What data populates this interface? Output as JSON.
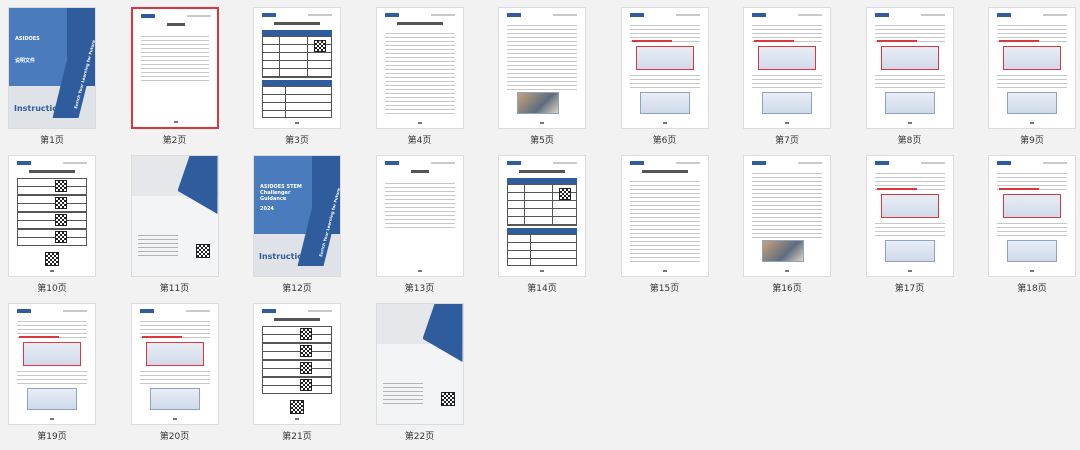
{
  "pages": [
    {
      "label": "第1页",
      "kind": "cover",
      "cover_title": "ASIDOES",
      "cover_sub": "说明文件",
      "cover_brand": "Instructions",
      "cover_slogan": "Enrich Your Learning for Future"
    },
    {
      "label": "第2页",
      "kind": "toc",
      "selected": true
    },
    {
      "label": "第3页",
      "kind": "table"
    },
    {
      "label": "第4页",
      "kind": "text"
    },
    {
      "label": "第5页",
      "kind": "photo"
    },
    {
      "label": "第6页",
      "kind": "screens"
    },
    {
      "label": "第7页",
      "kind": "screens"
    },
    {
      "label": "第8页",
      "kind": "screens"
    },
    {
      "label": "第9页",
      "kind": "screens"
    },
    {
      "label": "第10页",
      "kind": "qrlist"
    },
    {
      "label": "第11页",
      "kind": "back"
    },
    {
      "label": "第12页",
      "kind": "cover",
      "cover_title": "ASIDOES STEM Challenger Guidance",
      "cover_sub": "2024",
      "cover_brand": "Instructions",
      "cover_slogan": "Enrich Your Learning for Future"
    },
    {
      "label": "第13页",
      "kind": "toc"
    },
    {
      "label": "第14页",
      "kind": "table"
    },
    {
      "label": "第15页",
      "kind": "text"
    },
    {
      "label": "第16页",
      "kind": "photo"
    },
    {
      "label": "第17页",
      "kind": "screens"
    },
    {
      "label": "第18页",
      "kind": "screens"
    },
    {
      "label": "第19页",
      "kind": "screens"
    },
    {
      "label": "第20页",
      "kind": "screens"
    },
    {
      "label": "第21页",
      "kind": "qrlist"
    },
    {
      "label": "第22页",
      "kind": "back"
    }
  ],
  "colors": {
    "brand_blue": "#2f5c9c",
    "selected_border": "#d9363e"
  }
}
